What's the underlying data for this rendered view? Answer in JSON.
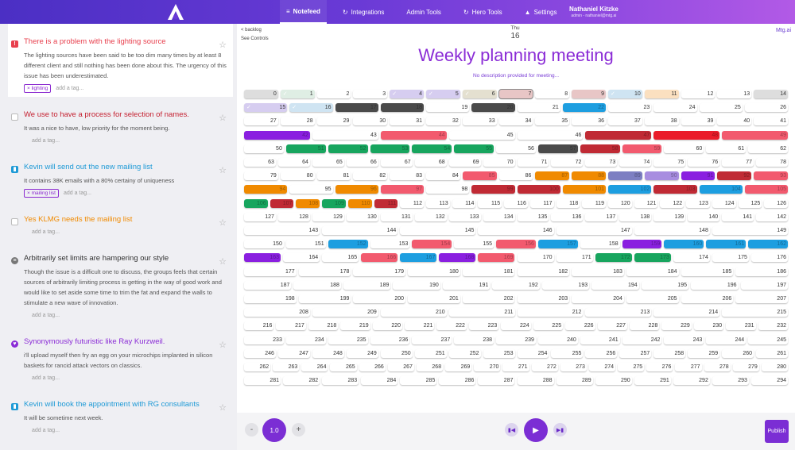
{
  "nav": {
    "items": [
      {
        "label": "Notefeed",
        "icon": "list-icon",
        "glyph": "≡"
      },
      {
        "label": "Integrations",
        "icon": "sync-icon",
        "glyph": "↻"
      },
      {
        "label": "Admin Tools",
        "icon": "",
        "glyph": ""
      },
      {
        "label": "Hero Tools",
        "icon": "cycle-icon",
        "glyph": "↻"
      },
      {
        "label": "Settings",
        "icon": "user-icon",
        "glyph": "▲"
      }
    ],
    "active": 0
  },
  "user": {
    "name": "Nathaniel Kitzke",
    "role": "admin - nathaniel@mtg.ai"
  },
  "colors": {
    "accent": "#7b2ed4",
    "title": "#8a2bd6"
  },
  "issues": [
    {
      "title": "There is a problem with the lighting source",
      "color": "#e8404e",
      "badge": "!",
      "desc": "The lighting sources have been said to be too dim many times by at least 8 different client and still nothing has been done about this. The urgency of this issue has been underestimated.",
      "tags": [
        "lighting"
      ],
      "add_tag": "add a tag...",
      "selected": true
    },
    {
      "title": "We use to have a process for selection of names.",
      "color": "#c41e2e",
      "badge": "",
      "desc": "It was a nice to have, low priority for the moment being.",
      "tags": [],
      "add_tag": "add a tag...",
      "selected": false
    },
    {
      "title": "Kevin will send out the new mailing list",
      "color": "#1e9ad6",
      "badge": "▮",
      "desc": "It contains 38K emails with a 80% certainy of uniqueness",
      "tags": [
        "mailing list"
      ],
      "add_tag": "add a tag...",
      "selected": false
    },
    {
      "title": "Yes KLMG needs the mailing list",
      "color": "#f08a00",
      "badge": "",
      "desc": "",
      "tags": [],
      "add_tag": "add a tag...",
      "selected": false
    },
    {
      "title": "Arbitrarily set limits are hampering our style",
      "color": "#333333",
      "badge": "≡",
      "desc": "Though the issue is a difficult one to discuss, the groups feels that certain sources of arbitrarily limiting process is getting in the way of good work and would like to set aside some time to trim the fat and expand the walls to stimulate a new wave of innovation.",
      "tags": [],
      "add_tag": "add a tag...",
      "selected": false
    },
    {
      "title": "Synonymously futuristic like Ray Kurzweil.",
      "color": "#8a2bd6",
      "badge": "♥",
      "desc": "i'll upload myself then fry an egg on your microchips implanted in silicon baskets for rancid attack vectors on classics.",
      "tags": [],
      "add_tag": "add a tag...",
      "selected": false
    },
    {
      "title": "Kevin will book the appointment with RG consultants",
      "color": "#1e9ad6",
      "badge": "▮",
      "desc": "It will be sometime next week.",
      "tags": [],
      "add_tag": "add a tag...",
      "selected": false
    }
  ],
  "main": {
    "backlog": "< backlog",
    "see_controls": "See Controls",
    "day_of_week": "Thu",
    "day": "16",
    "mtg_link": "Mtg.ai",
    "title": "Weekly planning meeting",
    "description": "No description provided for meeting..."
  },
  "controls": {
    "minus": "-",
    "speed": "1.0",
    "plus": "+",
    "publish": "Publish"
  },
  "grid": {
    "palette": {
      "w": "#ffffff",
      "g": "#dfeee4",
      "l": "#d6cdf0",
      "o": "#fbe0c0",
      "p": "#e8c6c6",
      "b": "#cfe4f2",
      "k": "#4a4a4a",
      "r": "#f25a6e",
      "d": "#c02a34",
      "G": "#17a55e",
      "B": "#1d9ee0",
      "O": "#f08a00",
      "P": "#8a1fe0",
      "m": "#a88de0",
      "s": "#7d7fc2",
      "R": "#ea1c2a",
      "c": "#e4e0d0",
      "y": "#dddddd"
    },
    "rows": [
      [
        [
          0,
          "y"
        ],
        [
          1,
          "g",
          1
        ],
        [
          2
        ],
        [
          3
        ],
        [
          4,
          "l",
          1
        ],
        [
          5,
          "l",
          1
        ],
        [
          6,
          "c",
          1
        ],
        [
          7,
          "p",
          2
        ],
        [
          8
        ],
        [
          9,
          "p"
        ],
        [
          10,
          "b",
          1
        ],
        [
          11,
          "o",
          3
        ],
        [
          12
        ],
        [
          13
        ],
        [
          14,
          "y"
        ]
      ],
      [
        [
          15,
          "l",
          1
        ],
        [
          16,
          "b",
          1
        ],
        [
          17,
          "k"
        ],
        [
          18,
          "k"
        ],
        [
          19
        ],
        [
          20,
          "k"
        ],
        [
          21
        ],
        [
          22,
          "B"
        ],
        [
          23
        ],
        [
          24
        ],
        [
          25
        ],
        [
          26
        ]
      ],
      [
        [
          27
        ],
        [
          28
        ],
        [
          29
        ],
        [
          30
        ],
        [
          31
        ],
        [
          32
        ],
        [
          33
        ],
        [
          34
        ],
        [
          35
        ],
        [
          36
        ],
        [
          37
        ],
        [
          38
        ],
        [
          39
        ],
        [
          40
        ],
        [
          41
        ]
      ],
      [
        [
          42,
          "P"
        ],
        [
          43
        ],
        [
          44,
          "r"
        ],
        [
          45
        ],
        [
          46
        ],
        [
          47,
          "d"
        ],
        [
          48,
          "R"
        ],
        [
          49,
          "r"
        ]
      ],
      [
        [
          50
        ],
        [
          51,
          "G"
        ],
        [
          52,
          "G"
        ],
        [
          53,
          "G"
        ],
        [
          54,
          "G"
        ],
        [
          55,
          "G"
        ],
        [
          56
        ],
        [
          57,
          "k"
        ],
        [
          58,
          "d"
        ],
        [
          59,
          "r"
        ],
        [
          60
        ],
        [
          61
        ],
        [
          62
        ]
      ],
      [
        [
          63
        ],
        [
          64
        ],
        [
          65
        ],
        [
          66
        ],
        [
          67
        ],
        [
          68
        ],
        [
          69
        ],
        [
          70
        ],
        [
          71
        ],
        [
          72
        ],
        [
          73
        ],
        [
          74
        ],
        [
          75
        ],
        [
          76
        ],
        [
          77
        ],
        [
          78
        ]
      ],
      [
        [
          79
        ],
        [
          80
        ],
        [
          81
        ],
        [
          82
        ],
        [
          83
        ],
        [
          84
        ],
        [
          85,
          "r"
        ],
        [
          86
        ],
        [
          87,
          "O"
        ],
        [
          88,
          "O"
        ],
        [
          89,
          "s"
        ],
        [
          90,
          "m"
        ],
        [
          91,
          "P"
        ],
        [
          92,
          "d"
        ],
        [
          93,
          "r"
        ]
      ],
      [
        [
          94,
          "O"
        ],
        [
          95
        ],
        [
          96,
          "O"
        ],
        [
          97,
          "r"
        ],
        [
          98
        ],
        [
          99,
          "d"
        ],
        [
          100,
          "d"
        ],
        [
          101,
          "O"
        ],
        [
          102,
          "B"
        ],
        [
          103,
          "d"
        ],
        [
          104,
          "B"
        ],
        [
          105,
          "r"
        ]
      ],
      [
        [
          106,
          "G"
        ],
        [
          107,
          "d"
        ],
        [
          108,
          "O"
        ],
        [
          109,
          "G"
        ],
        [
          110,
          "O"
        ],
        [
          111,
          "d"
        ],
        [
          112
        ],
        [
          113
        ],
        [
          114
        ],
        [
          115
        ],
        [
          116
        ],
        [
          117
        ],
        [
          118
        ],
        [
          119
        ],
        [
          120
        ],
        [
          121
        ],
        [
          122
        ],
        [
          123
        ],
        [
          124
        ],
        [
          125
        ],
        [
          126
        ]
      ],
      [
        [
          127
        ],
        [
          128
        ],
        [
          129
        ],
        [
          130
        ],
        [
          131
        ],
        [
          132
        ],
        [
          133
        ],
        [
          134
        ],
        [
          135
        ],
        [
          136
        ],
        [
          137
        ],
        [
          138
        ],
        [
          139
        ],
        [
          140
        ],
        [
          141
        ],
        [
          142
        ]
      ],
      [
        [
          143
        ],
        [
          144
        ],
        [
          145
        ],
        [
          146
        ],
        [
          147
        ],
        [
          148
        ],
        [
          149
        ]
      ],
      [
        [
          150
        ],
        [
          151
        ],
        [
          152,
          "B"
        ],
        [
          153
        ],
        [
          154,
          "r"
        ],
        [
          155
        ],
        [
          156,
          "r"
        ],
        [
          157,
          "B"
        ],
        [
          158
        ],
        [
          159,
          "P"
        ],
        [
          160,
          "B"
        ],
        [
          161,
          "B"
        ],
        [
          162,
          "B"
        ]
      ],
      [
        [
          163,
          "P"
        ],
        [
          164
        ],
        [
          165
        ],
        [
          166,
          "r"
        ],
        [
          167,
          "B"
        ],
        [
          168,
          "P"
        ],
        [
          169,
          "r"
        ],
        [
          170
        ],
        [
          171
        ],
        [
          172,
          "G"
        ],
        [
          173,
          "G"
        ],
        [
          174
        ],
        [
          175
        ],
        [
          176
        ]
      ],
      [
        [
          177
        ],
        [
          178
        ],
        [
          179
        ],
        [
          180
        ],
        [
          181
        ],
        [
          182
        ],
        [
          183
        ],
        [
          184
        ],
        [
          185
        ],
        [
          186
        ]
      ],
      [
        [
          187
        ],
        [
          188
        ],
        [
          189
        ],
        [
          190
        ],
        [
          191
        ],
        [
          192
        ],
        [
          193
        ],
        [
          194
        ],
        [
          195
        ],
        [
          196
        ],
        [
          197
        ]
      ],
      [
        [
          198
        ],
        [
          199
        ],
        [
          200
        ],
        [
          201
        ],
        [
          202
        ],
        [
          203
        ],
        [
          204
        ],
        [
          205
        ],
        [
          206
        ],
        [
          207
        ]
      ],
      [
        [
          208
        ],
        [
          209
        ],
        [
          210
        ],
        [
          211
        ],
        [
          212
        ],
        [
          213
        ],
        [
          214
        ],
        [
          215
        ]
      ],
      [
        [
          216
        ],
        [
          217
        ],
        [
          218
        ],
        [
          219
        ],
        [
          220
        ],
        [
          221
        ],
        [
          222
        ],
        [
          223
        ],
        [
          224
        ],
        [
          225
        ],
        [
          226
        ],
        [
          227
        ],
        [
          228
        ],
        [
          229
        ],
        [
          230
        ],
        [
          231
        ],
        [
          232
        ]
      ],
      [
        [
          233
        ],
        [
          234
        ],
        [
          235
        ],
        [
          236
        ],
        [
          237
        ],
        [
          238
        ],
        [
          239
        ],
        [
          240
        ],
        [
          241
        ],
        [
          242
        ],
        [
          243
        ],
        [
          244
        ],
        [
          245
        ]
      ],
      [
        [
          246
        ],
        [
          247
        ],
        [
          248
        ],
        [
          249
        ],
        [
          250
        ],
        [
          251
        ],
        [
          252
        ],
        [
          253
        ],
        [
          254
        ],
        [
          255
        ],
        [
          256
        ],
        [
          257
        ],
        [
          258
        ],
        [
          259
        ],
        [
          260
        ],
        [
          261
        ]
      ],
      [
        [
          262
        ],
        [
          263
        ],
        [
          264
        ],
        [
          265
        ],
        [
          266
        ],
        [
          267
        ],
        [
          268
        ],
        [
          269
        ],
        [
          270
        ],
        [
          271
        ],
        [
          272
        ],
        [
          273
        ],
        [
          274
        ],
        [
          275
        ],
        [
          276
        ],
        [
          277
        ],
        [
          278
        ],
        [
          279
        ],
        [
          280
        ]
      ],
      [
        [
          281
        ],
        [
          282
        ],
        [
          283
        ],
        [
          284
        ],
        [
          285
        ],
        [
          286
        ],
        [
          287
        ],
        [
          288
        ],
        [
          289
        ],
        [
          290
        ],
        [
          291
        ],
        [
          292
        ],
        [
          293
        ],
        [
          294
        ]
      ]
    ]
  }
}
